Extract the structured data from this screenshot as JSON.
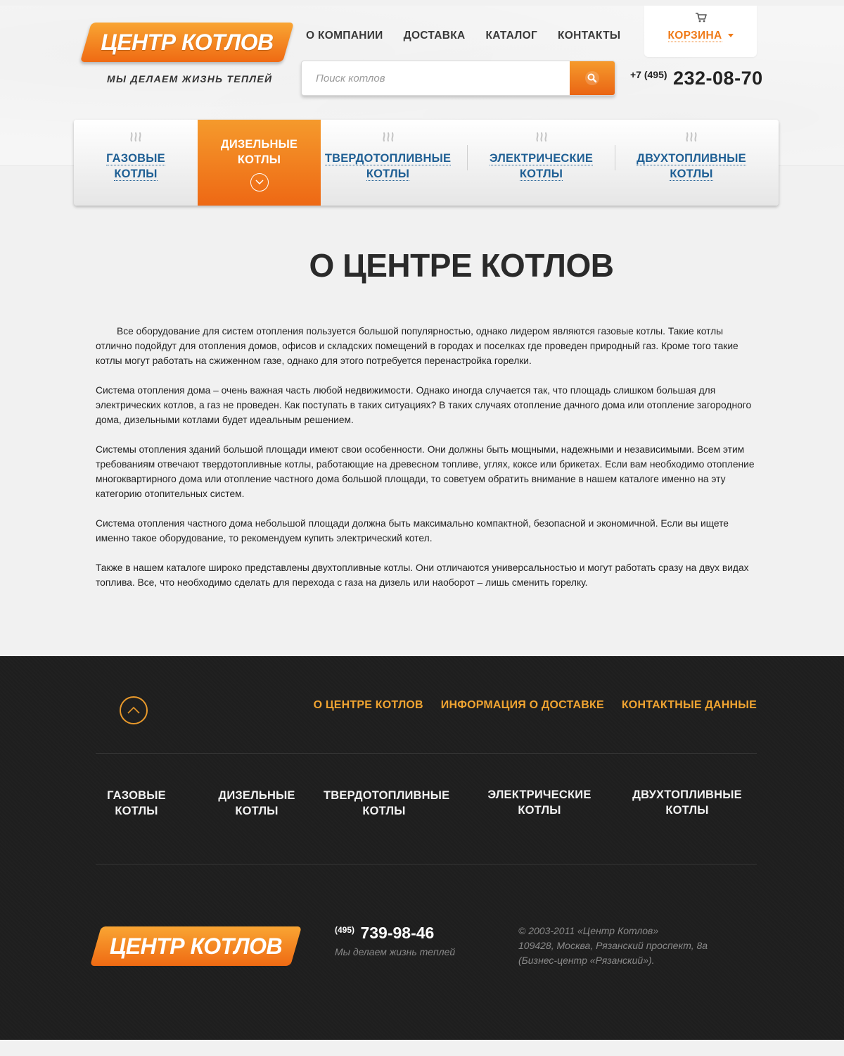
{
  "header": {
    "logo_text": "ЦЕНТР КОТЛОВ",
    "tagline": "МЫ ДЕЛАЕМ ЖИЗНЬ ТЕПЛЕЙ",
    "nav": [
      {
        "label": "О КОМПАНИИ"
      },
      {
        "label": "ДОСТАВКА"
      },
      {
        "label": "КАТАЛОГ"
      },
      {
        "label": "КОНТАКТЫ"
      }
    ],
    "search": {
      "placeholder": "Поиск котлов",
      "button_icon": "search-icon"
    },
    "cart": {
      "label": "КОРЗИНА",
      "icon": "cart-icon"
    },
    "phone": {
      "code": "+7 (495)",
      "number": "232-08-70"
    }
  },
  "categories": [
    {
      "line1": "ГАЗОВЫЕ",
      "line2": "КОТЛЫ",
      "active": false
    },
    {
      "line1": "ДИЗЕЛЬНЫЕ",
      "line2": "КОТЛЫ",
      "active": true
    },
    {
      "line1": "ТВЕРДОТОПЛИВНЫЕ",
      "line2": "КОТЛЫ",
      "active": false
    },
    {
      "line1": "ЭЛЕКТРИЧЕСКИЕ",
      "line2": "КОТЛЫ",
      "active": false
    },
    {
      "line1": "ДВУХТОПЛИВНЫЕ",
      "line2": "КОТЛЫ",
      "active": false
    }
  ],
  "main": {
    "title": "О  ЦЕНТРЕ КОТЛОВ",
    "paragraphs": [
      "Все оборудование для систем отопления пользуется большой популярностью, однако лидером являются газовые котлы. Такие котлы отлично подойдут для отопления домов, офисов и складских помещений в городах и поселках где проведен природный газ. Кроме того такие котлы могут работать на сжиженном газе, однако для этого потребуется перенастройка горелки.",
      "Система отопления дома – очень важная часть любой недвижимости. Однако иногда случается так, что площадь слишком большая для электрических котлов, а газ не проведен. Как поступать в таких ситуациях? В таких случаях отопление дачного дома или отопление загородного дома, дизельными котлами будет идеальным решением.",
      "Системы отопления зданий большой площади имеют свои особенности. Они должны быть мощными, надежными и независимыми. Всем этим требованиям отвечают твердотопливные котлы, работающие на древесном топливе, углях, коксе или брикетах. Если вам необходимо отопление многоквартирного дома или отопление частного дома большой площади, то советуем обратить внимание в нашем каталоге именно на эту категорию отопительных систем.",
      "Система отопления частного дома небольшой площади должна быть максимально компактной, безопасной и экономичной. Если вы ищете именно такое оборудование, то рекомендуем купить электрический котел.",
      "Также в нашем каталоге широко представлены двухтопливные котлы. Они отличаются универсальностью и могут работать сразу на двух видах топлива. Все, что необходимо сделать для перехода с газа на дизель или наоборот – лишь сменить горелку."
    ]
  },
  "footer": {
    "nav": [
      {
        "label": "О ЦЕНТРЕ КОТЛОВ"
      },
      {
        "label": "ИНФОРМАЦИЯ О ДОСТАВКЕ"
      },
      {
        "label": "КОНТАКТНЫЕ ДАННЫЕ"
      }
    ],
    "categories": [
      {
        "line1": "ГАЗОВЫЕ",
        "line2": "КОТЛЫ"
      },
      {
        "line1": "ДИЗЕЛЬНЫЕ",
        "line2": "КОТЛЫ"
      },
      {
        "line1": "ТВЕРДОТОПЛИВНЫЕ",
        "line2": "КОТЛЫ"
      },
      {
        "line1": "ЭЛЕКТРИЧЕСКИЕ",
        "line2": "КОТЛЫ"
      },
      {
        "line1": "ДВУХТОПЛИВНЫЕ",
        "line2": "КОТЛЫ"
      }
    ],
    "logo_text": "ЦЕНТР КОТЛОВ",
    "phone": {
      "code": "(495)",
      "number": "739-98-46"
    },
    "tagline": "Мы делаем жизнь теплей",
    "copyright": "© 2003-2011 «Центр Котлов»",
    "address1": "109428, Москва, Рязанский проспект, 8а",
    "address2": "(Бизнес-центр «Рязанский»)."
  },
  "colors": {
    "accent": "#ef7a18",
    "link": "#1f5f94",
    "footer_bg": "#1e1e1e",
    "footer_link": "#f0a431"
  }
}
